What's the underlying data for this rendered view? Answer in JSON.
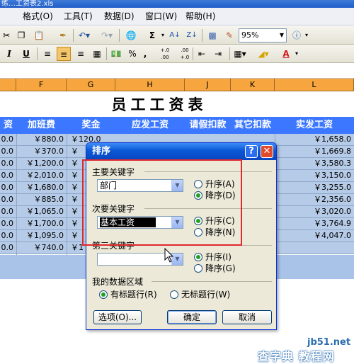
{
  "window": {
    "title": "练…工资表2.xls"
  },
  "menu": [
    {
      "label": "格式(O)"
    },
    {
      "label": "工具(T)"
    },
    {
      "label": "数据(D)"
    },
    {
      "label": "窗口(W)"
    },
    {
      "label": "帮助(H)"
    }
  ],
  "toolbar": {
    "zoom": "95%",
    "sigma": "Σ",
    "percent": "%",
    "comma": ",",
    "inc_decimal": "+.0 .00",
    "dec_decimal": ".00 +.0",
    "bold": "I",
    "underline": "U"
  },
  "columns": [
    "",
    "F",
    "G",
    "H",
    "J",
    "K",
    "L"
  ],
  "sheet": {
    "title": "员工工资表",
    "headers": [
      "资",
      "加班费",
      "奖金",
      "应发工资",
      "请假扣款",
      "其它扣款",
      "实发工资"
    ],
    "rows": [
      [
        "0.0",
        "￥880.0",
        "￥120.0",
        "",
        "",
        "",
        "￥1,658.0"
      ],
      [
        "0.0",
        "￥370.0",
        "￥",
        "",
        "",
        "",
        "￥1,669.8"
      ],
      [
        "0.0",
        "￥1,200.0",
        "￥",
        "",
        "",
        "",
        "￥3,580.3"
      ],
      [
        "0.0",
        "￥2,010.0",
        "￥",
        "",
        "",
        "",
        "￥3,150.0"
      ],
      [
        "0.0",
        "￥1,680.0",
        "￥",
        "",
        "",
        "",
        "￥3,255.0"
      ],
      [
        "0.0",
        "￥885.0",
        "￥",
        "",
        "",
        "",
        "￥2,356.0"
      ],
      [
        "0.0",
        "￥1,065.0",
        "￥",
        "",
        "",
        "",
        "￥3,020.0"
      ],
      [
        "0.0",
        "￥1,700.0",
        "￥",
        "",
        "",
        "",
        "￥3,764.9"
      ],
      [
        "0.0",
        "￥1,095.0",
        "￥",
        "",
        "",
        "",
        "￥4,047.0"
      ],
      [
        "0.0",
        "￥740.0",
        "￥1",
        "",
        "",
        "",
        ""
      ]
    ]
  },
  "dialog": {
    "title": "排序",
    "help": "?",
    "close": "✕",
    "primary_label": "主要关键字",
    "primary_value": "部门",
    "secondary_label": "次要关键字",
    "secondary_value": "基本工资",
    "tertiary_label": "第三关键字",
    "tertiary_value": "",
    "asc_a": "升序(A)",
    "desc_d": "降序(D)",
    "asc_c": "升序(C)",
    "desc_n": "降序(N)",
    "asc_i": "升序(I)",
    "desc_g": "降序(G)",
    "range_label": "我的数据区域",
    "has_header": "有标题行(R)",
    "no_header": "无标题行(W)",
    "options_btn": "选项(O)...",
    "ok_btn": "确定",
    "cancel_btn": "取消"
  },
  "watermark": {
    "site": "jb51.net",
    "text": "查字典 教程网"
  }
}
